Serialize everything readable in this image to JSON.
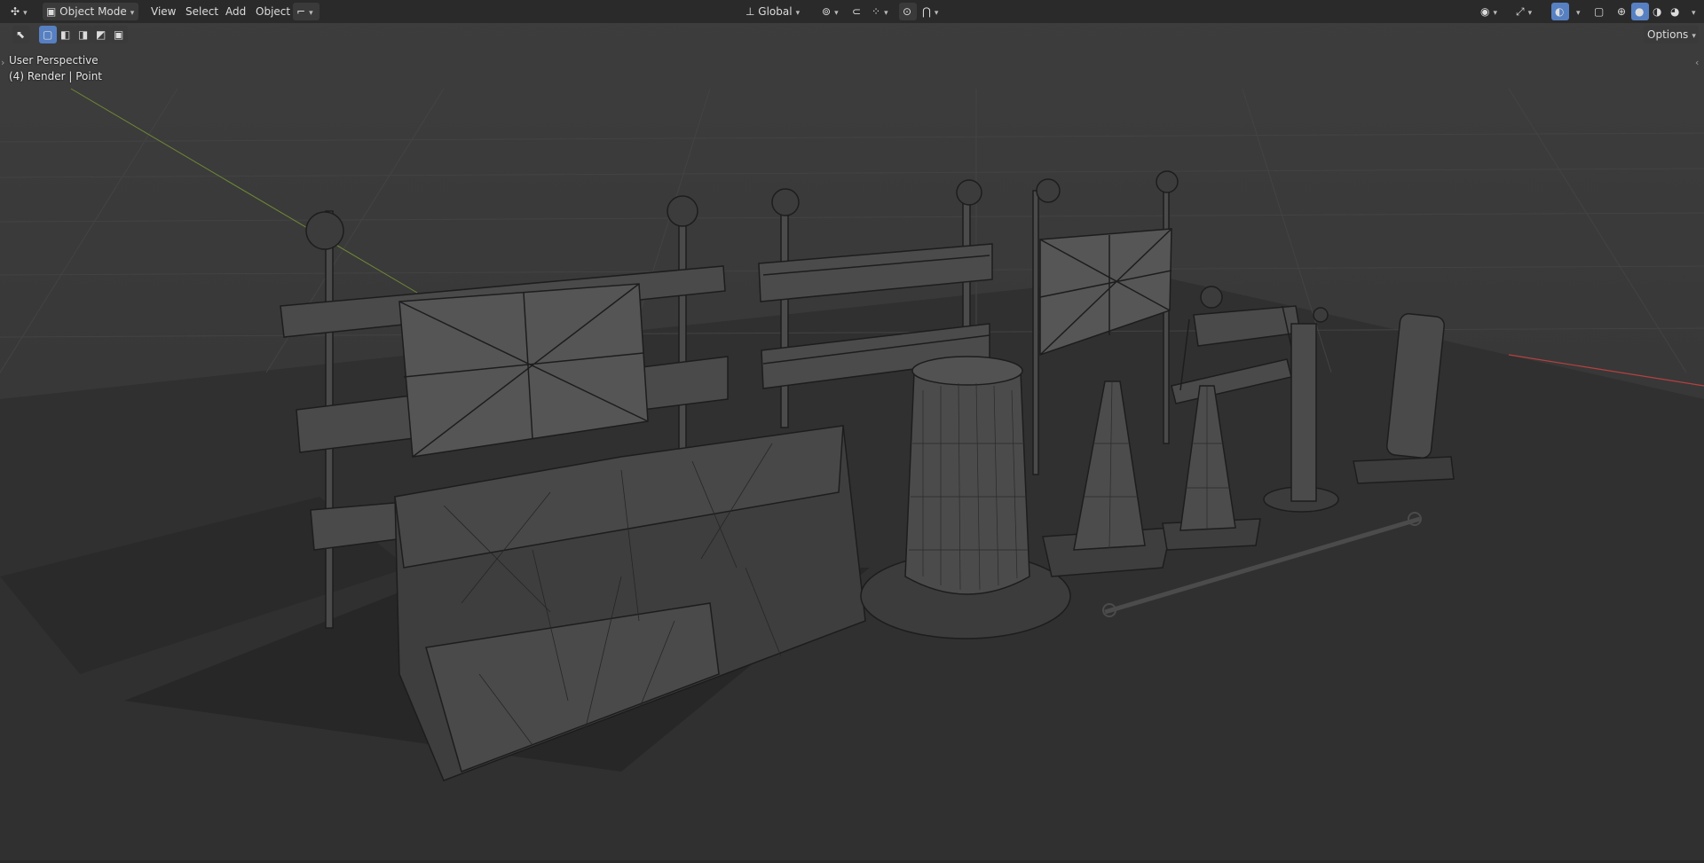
{
  "header": {
    "editor_type_icon": "grid-editor-icon",
    "mode": "Object Mode",
    "menus": [
      "View",
      "Select",
      "Add",
      "Object"
    ],
    "transform_orientation": "Global",
    "options_label": "Options"
  },
  "viewport": {
    "perspective_label": "User Perspective",
    "collection_label": "(4) Render | Point"
  },
  "icons": {
    "select_tool": "cursor-select-icon",
    "select_modes": [
      "select-new-icon",
      "select-extend-icon",
      "select-subtract-icon",
      "select-difference-icon",
      "select-intersect-icon"
    ],
    "pivot": "pivot-icon",
    "snap": "snap-icon",
    "proportional": "proportional-edit-icon",
    "visibility": "visibility-icon",
    "gizmo": "gizmo-icon",
    "overlay": "overlay-icon",
    "xray": "xray-icon",
    "shading_modes": [
      "wireframe-shading-icon",
      "solid-shading-icon",
      "material-shading-icon",
      "rendered-shading-icon"
    ]
  },
  "colors": {
    "header_bg": "#2a2a2a",
    "viewport_bg": "#393939",
    "active_blue": "#5680c2",
    "grid_line": "#404040",
    "x_axis": "#c04848",
    "y_axis": "#7a9a3a"
  }
}
